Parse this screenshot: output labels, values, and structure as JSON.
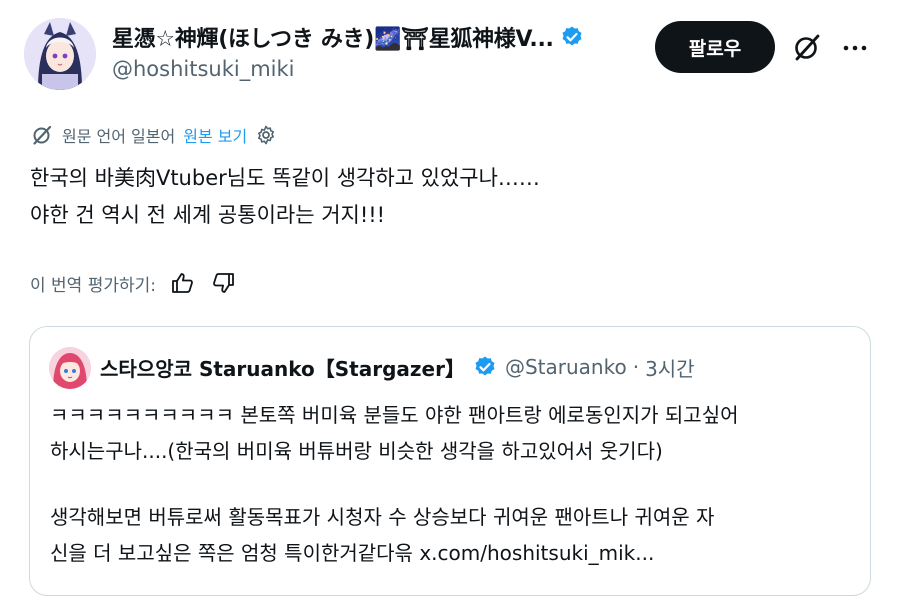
{
  "author": {
    "display_name": "星憑☆神輝(ほしつき みき)🌌⛩星狐神様V...",
    "handle": "@hoshitsuki_miki"
  },
  "header_actions": {
    "follow_label": "팔로우",
    "grok_icon": "grok-icon",
    "more_icon": "more-icon"
  },
  "translation": {
    "info": "원문 언어 일본어",
    "show_original": "원본 보기"
  },
  "tweet": {
    "lines": [
      "한국의 바美肉Vtuber님도 똑같이 생각하고 있었구나……",
      "야한 건 역시 전 세계 공통이라는 거지!!!"
    ]
  },
  "rating": {
    "label": "이 번역 평가하기:"
  },
  "quote": {
    "name": "스타으앙코 Staruanko【Stargazer】",
    "handle": "@Staruanko",
    "dot": "·",
    "time": "3시간",
    "lines": [
      "ㅋㅋㅋㅋㅋㅋㅋㅋㅋㅋ 본토쪽 버미육 분들도 야한 팬아트랑 에로동인지가 되고싶어",
      "하시는구나....(한국의 버미육 버튜버랑 비슷한 생각을 하고있어서 웃기다)",
      "생각해보면 버튜로써 활동목표가 시청자 수 상승보다 귀여운 팬아트나 귀여운 자",
      "신을 더 보고싶은 쪽은 엄청 특이한거같다윾 x.com/hoshitsuki_mik..."
    ]
  },
  "colors": {
    "text": "#0f1419",
    "secondary": "#536471",
    "link": "#1d9bf0",
    "verified": "#1d9bf0",
    "border": "#cfd9de",
    "button": "#0f1419"
  }
}
